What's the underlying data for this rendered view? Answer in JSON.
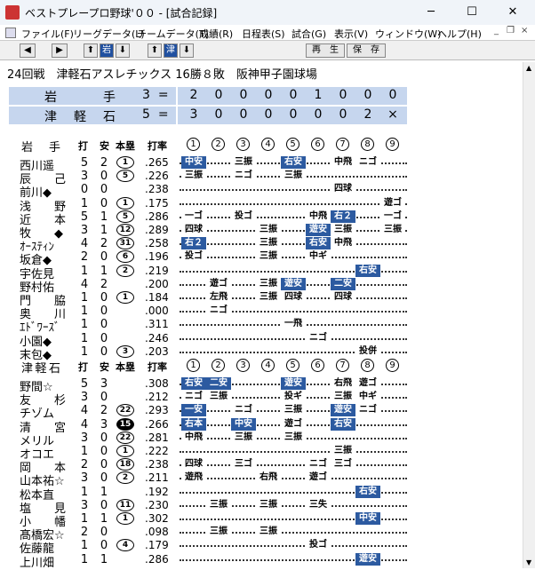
{
  "window": {
    "title": "ベストプレープロ野球'００ - [試合記録]",
    "minimize": "─",
    "maximize": "☐",
    "close": "✕"
  },
  "menu": [
    "ファイル(F)",
    "リーグデータ(L)",
    "チームデータ(T)",
    "成績(R)",
    "日程表(S)",
    "試合(G)",
    "表示(V)",
    "ウィンドウ(W)",
    "ヘルプ(H)"
  ],
  "mdi": {
    "min": "_",
    "restore": "❐",
    "close": "×"
  },
  "toolbar": {
    "prev": "◀",
    "next": "▶",
    "up1": "⬆",
    "team1": "岩",
    "down1": "⬇",
    "up2": "⬆",
    "team2": "津",
    "down2": "⬇",
    "replay": "再　生",
    "save": "保　存"
  },
  "game": {
    "title": "24回戦　津軽石アスレチックス 16勝８敗　阪神甲子園球場"
  },
  "score": {
    "away": {
      "name": "岩手",
      "runs": "3",
      "eq": "=",
      "innings": [
        "2",
        "0",
        "0",
        "0",
        "0",
        "1",
        "0",
        "0",
        "0"
      ]
    },
    "home": {
      "name": "津軽石",
      "runs": "5",
      "eq": "=",
      "innings": [
        "3",
        "0",
        "0",
        "0",
        "0",
        "0",
        "0",
        "2",
        "×"
      ]
    }
  },
  "headers": {
    "ab": "打",
    "h": "安",
    "hr": "本塁",
    "avg": "打率",
    "innings": [
      "1",
      "2",
      "3",
      "4",
      "5",
      "6",
      "7",
      "8",
      "9"
    ]
  },
  "teams": [
    {
      "name": "岩　手",
      "players": [
        {
          "name": "西川遥",
          "ab": "5",
          "h": "2",
          "hr": "1",
          "hrblack": false,
          "avg": ".265",
          "pa": [
            "中安",
            "",
            "三振",
            "",
            "右安",
            "",
            "中飛",
            "ニゴ",
            ""
          ],
          "hit": [
            1,
            0,
            0,
            0,
            1,
            0,
            0,
            0,
            0
          ]
        },
        {
          "name": "辰　　己",
          "ab": "3",
          "h": "0",
          "hr": "5",
          "hrblack": false,
          "avg": ".226",
          "pa": [
            "三振",
            "",
            "ニゴ",
            "",
            "三振",
            "",
            "",
            "",
            ""
          ],
          "hit": [
            0,
            0,
            0,
            0,
            0,
            0,
            0,
            0,
            0
          ]
        },
        {
          "name": "前川◆",
          "ab": "0",
          "h": "0",
          "hr": "",
          "hrblack": false,
          "avg": ".238",
          "pa": [
            "",
            "",
            "",
            "",
            "",
            "",
            "四球",
            "",
            ""
          ],
          "hit": [
            0,
            0,
            0,
            0,
            0,
            0,
            0,
            0,
            0
          ]
        },
        {
          "name": "浅　　野",
          "ab": "1",
          "h": "0",
          "hr": "1",
          "hrblack": false,
          "avg": ".175",
          "pa": [
            "",
            "",
            "",
            "",
            "",
            "",
            "",
            "",
            "遊ゴ"
          ],
          "hit": [
            0,
            0,
            0,
            0,
            0,
            0,
            0,
            0,
            0
          ]
        },
        {
          "name": "近　　本",
          "ab": "5",
          "h": "1",
          "hr": "5",
          "hrblack": false,
          "avg": ".286",
          "pa": [
            "一ゴ",
            "",
            "投ゴ",
            "",
            "",
            "中飛",
            "右２",
            "",
            "一ゴ"
          ],
          "hit": [
            0,
            0,
            0,
            0,
            0,
            0,
            1,
            0,
            0
          ]
        },
        {
          "name": "牧　　◆",
          "ab": "3",
          "h": "1",
          "hr": "12",
          "hrblack": false,
          "avg": ".289",
          "pa": [
            "四球",
            "",
            "",
            "三振",
            "",
            "遊安",
            "三振",
            "",
            "三振"
          ],
          "hit": [
            0,
            0,
            0,
            0,
            0,
            1,
            0,
            0,
            0
          ]
        },
        {
          "name": "ｵｰｽﾃｨﾝ",
          "ab": "4",
          "h": "2",
          "hr": "31",
          "hrblack": false,
          "avg": ".258",
          "pa": [
            "右２",
            "",
            "",
            "三振",
            "",
            "右安",
            "中飛",
            "",
            ""
          ],
          "hit": [
            1,
            0,
            0,
            0,
            0,
            1,
            0,
            0,
            0
          ]
        },
        {
          "name": "坂倉◆",
          "ab": "2",
          "h": "0",
          "hr": "6",
          "hrblack": false,
          "avg": ".196",
          "pa": [
            "投ゴ",
            "",
            "",
            "三振",
            "",
            "中ギ",
            "",
            "",
            ""
          ],
          "hit": [
            0,
            0,
            0,
            0,
            0,
            0,
            0,
            0,
            0
          ]
        },
        {
          "name": "宇佐見",
          "ab": "1",
          "h": "1",
          "hr": "2",
          "hrblack": false,
          "avg": ".219",
          "pa": [
            "",
            "",
            "",
            "",
            "",
            "",
            "",
            "右安",
            ""
          ],
          "hit": [
            0,
            0,
            0,
            0,
            0,
            0,
            0,
            1,
            0
          ]
        },
        {
          "name": "野村佑",
          "ab": "4",
          "h": "2",
          "hr": "",
          "hrblack": false,
          "avg": ".200",
          "pa": [
            "",
            "遊ゴ",
            "",
            "三振",
            "遊安",
            "",
            "二安",
            "",
            ""
          ],
          "hit": [
            0,
            0,
            0,
            0,
            1,
            0,
            1,
            0,
            0
          ]
        },
        {
          "name": "門　　脇",
          "ab": "1",
          "h": "0",
          "hr": "1",
          "hrblack": false,
          "avg": ".184",
          "pa": [
            "",
            "左飛",
            "",
            "三振",
            "四球",
            "",
            "四球",
            "",
            ""
          ],
          "hit": [
            0,
            0,
            0,
            0,
            0,
            0,
            0,
            0,
            0
          ]
        },
        {
          "name": "奥　　川",
          "ab": "1",
          "h": "0",
          "hr": "",
          "hrblack": false,
          "avg": ".000",
          "pa": [
            "",
            "ニゴ",
            "",
            "",
            "",
            "",
            "",
            "",
            ""
          ],
          "hit": [
            0,
            0,
            0,
            0,
            0,
            0,
            0,
            0,
            0
          ]
        },
        {
          "name": "ｴﾄﾞﾜｰｽﾞ",
          "ab": "1",
          "h": "0",
          "hr": "",
          "hrblack": false,
          "avg": ".311",
          "pa": [
            "",
            "",
            "",
            "",
            "一飛",
            "",
            "",
            "",
            ""
          ],
          "hit": [
            0,
            0,
            0,
            0,
            0,
            0,
            0,
            0,
            0
          ]
        },
        {
          "name": "小園◆",
          "ab": "1",
          "h": "0",
          "hr": "",
          "hrblack": false,
          "avg": ".246",
          "pa": [
            "",
            "",
            "",
            "",
            "",
            "ニゴ",
            "",
            "",
            ""
          ],
          "hit": [
            0,
            0,
            0,
            0,
            0,
            0,
            0,
            0,
            0
          ]
        },
        {
          "name": "末包◆",
          "ab": "1",
          "h": "0",
          "hr": "3",
          "hrblack": false,
          "avg": ".203",
          "pa": [
            "",
            "",
            "",
            "",
            "",
            "",
            "",
            "投併",
            ""
          ],
          "hit": [
            0,
            0,
            0,
            0,
            0,
            0,
            0,
            0,
            0
          ]
        }
      ]
    },
    {
      "name": "津軽石",
      "players": [
        {
          "name": "野間☆",
          "ab": "5",
          "h": "3",
          "hr": "",
          "hrblack": false,
          "avg": ".308",
          "pa": [
            "右安",
            "二安",
            "",
            "",
            "遊安",
            "",
            "右飛",
            "遊ゴ",
            ""
          ],
          "hit": [
            1,
            1,
            0,
            0,
            1,
            0,
            0,
            0,
            0
          ]
        },
        {
          "name": "友　　杉",
          "ab": "3",
          "h": "0",
          "hr": "",
          "hrblack": false,
          "avg": ".212",
          "pa": [
            "ニゴ",
            "三振",
            "",
            "",
            "投ギ",
            "",
            "三振",
            "中ギ",
            ""
          ],
          "hit": [
            0,
            0,
            0,
            0,
            0,
            0,
            0,
            0,
            0
          ]
        },
        {
          "name": "チゾム",
          "ab": "4",
          "h": "2",
          "hr": "22",
          "hrblack": false,
          "avg": ".293",
          "pa": [
            "一安",
            "",
            "ニゴ",
            "",
            "三振",
            "",
            "遊安",
            "ニゴ",
            ""
          ],
          "hit": [
            1,
            0,
            0,
            0,
            0,
            0,
            1,
            0,
            0
          ]
        },
        {
          "name": "清　　宮",
          "ab": "4",
          "h": "3",
          "hr": "15",
          "hrblack": true,
          "avg": ".266",
          "pa": [
            "右本",
            "",
            "中安",
            "",
            "遊ゴ",
            "",
            "右安",
            "",
            ""
          ],
          "hit": [
            1,
            0,
            1,
            0,
            0,
            0,
            1,
            0,
            0
          ]
        },
        {
          "name": "メリル",
          "ab": "3",
          "h": "0",
          "hr": "22",
          "hrblack": false,
          "avg": ".281",
          "pa": [
            "中飛",
            "",
            "三振",
            "",
            "三振",
            "",
            "",
            "",
            ""
          ],
          "hit": [
            0,
            0,
            0,
            0,
            0,
            0,
            0,
            0,
            0
          ]
        },
        {
          "name": "オコエ",
          "ab": "1",
          "h": "0",
          "hr": "1",
          "hrblack": false,
          "avg": ".222",
          "pa": [
            "",
            "",
            "",
            "",
            "",
            "",
            "三振",
            "",
            ""
          ],
          "hit": [
            0,
            0,
            0,
            0,
            0,
            0,
            0,
            0,
            0
          ]
        },
        {
          "name": "岡　　本",
          "ab": "2",
          "h": "0",
          "hr": "18",
          "hrblack": false,
          "avg": ".238",
          "pa": [
            "四球",
            "",
            "三ゴ",
            "",
            "",
            "ニゴ",
            "三ゴ",
            "",
            ""
          ],
          "hit": [
            0,
            0,
            0,
            0,
            0,
            0,
            0,
            0,
            0
          ]
        },
        {
          "name": "山本祐☆",
          "ab": "3",
          "h": "0",
          "hr": "2",
          "hrblack": false,
          "avg": ".211",
          "pa": [
            "遊飛",
            "",
            "",
            "右飛",
            "",
            "遊ゴ",
            "",
            "",
            ""
          ],
          "hit": [
            0,
            0,
            0,
            0,
            0,
            0,
            0,
            0,
            0
          ]
        },
        {
          "name": "松本直",
          "ab": "1",
          "h": "1",
          "hr": "",
          "hrblack": false,
          "avg": ".192",
          "pa": [
            "",
            "",
            "",
            "",
            "",
            "",
            "",
            "右安",
            ""
          ],
          "hit": [
            0,
            0,
            0,
            0,
            0,
            0,
            0,
            1,
            0
          ]
        },
        {
          "name": "塩　　見",
          "ab": "3",
          "h": "0",
          "hr": "11",
          "hrblack": false,
          "avg": ".230",
          "pa": [
            "",
            "三振",
            "",
            "三振",
            "",
            "三失",
            "",
            "",
            ""
          ],
          "hit": [
            0,
            0,
            0,
            0,
            0,
            0,
            0,
            0,
            0
          ]
        },
        {
          "name": "小　　幡",
          "ab": "1",
          "h": "1",
          "hr": "1",
          "hrblack": false,
          "avg": ".302",
          "pa": [
            "",
            "",
            "",
            "",
            "",
            "",
            "",
            "中安",
            ""
          ],
          "hit": [
            0,
            0,
            0,
            0,
            0,
            0,
            0,
            1,
            0
          ]
        },
        {
          "name": "髙橋宏☆",
          "ab": "2",
          "h": "0",
          "hr": "",
          "hrblack": false,
          "avg": ".098",
          "pa": [
            "",
            "三振",
            "",
            "三振",
            "",
            "",
            "",
            "",
            ""
          ],
          "hit": [
            0,
            0,
            0,
            0,
            0,
            0,
            0,
            0,
            0
          ]
        },
        {
          "name": "佐藤龍",
          "ab": "1",
          "h": "0",
          "hr": "4",
          "hrblack": false,
          "avg": ".179",
          "pa": [
            "",
            "",
            "",
            "",
            "",
            "投ゴ",
            "",
            "",
            ""
          ],
          "hit": [
            0,
            0,
            0,
            0,
            0,
            0,
            0,
            0,
            0
          ]
        },
        {
          "name": "上川畑",
          "ab": "1",
          "h": "1",
          "hr": "",
          "hrblack": false,
          "avg": ".286",
          "pa": [
            "",
            "",
            "",
            "",
            "",
            "",
            "",
            "遊安",
            ""
          ],
          "hit": [
            0,
            0,
            0,
            0,
            0,
            0,
            0,
            1,
            0
          ]
        }
      ]
    }
  ]
}
